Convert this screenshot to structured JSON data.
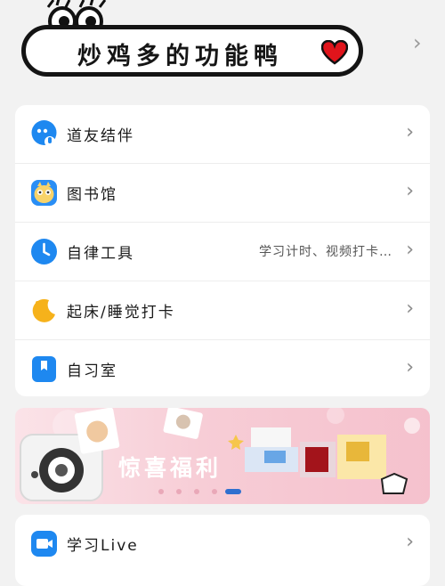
{
  "header": {
    "title": "炒鸡多的功能鸭",
    "chevron": "›"
  },
  "menu": [
    {
      "label": "道友结伴",
      "icon": "friends-bubble-icon",
      "sub": ""
    },
    {
      "label": "图书馆",
      "icon": "library-mascot-icon",
      "sub": ""
    },
    {
      "label": "自律工具",
      "icon": "clock-icon",
      "sub": "学习计时、视频打卡…"
    },
    {
      "label": "起床/睡觉打卡",
      "icon": "moon-icon",
      "sub": ""
    },
    {
      "label": "自习室",
      "icon": "bookmark-icon",
      "sub": ""
    }
  ],
  "banner": {
    "text": "惊喜福利",
    "active_dot": 4,
    "dot_count": 5
  },
  "menu2": [
    {
      "label": "学习Live",
      "icon": "video-camera-icon"
    }
  ],
  "chevron": "›",
  "colors": {
    "accent_blue": "#1e88f0",
    "accent_yellow": "#f6b21b",
    "heart_red": "#e0141b"
  }
}
